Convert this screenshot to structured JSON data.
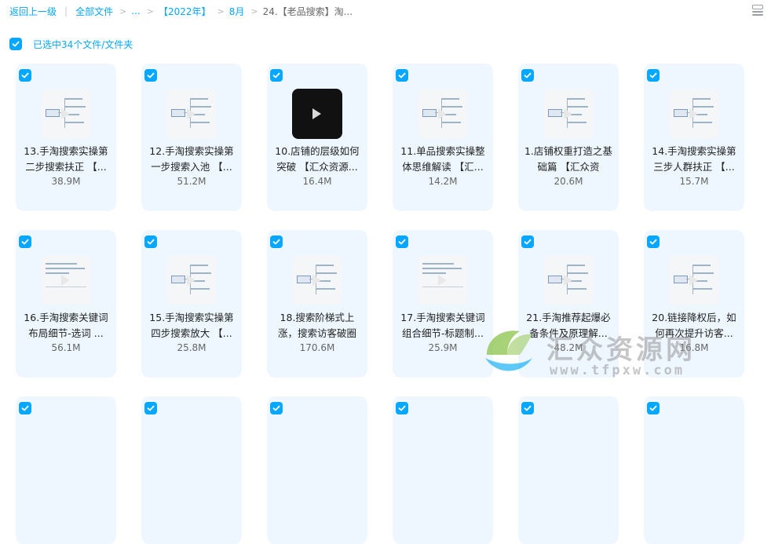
{
  "breadcrumb": {
    "back": "返回上一级",
    "root": "全部文件",
    "ellipsis": "...",
    "year": "【2022年】",
    "month": "8月",
    "current": "24.【老品搜索】淘..."
  },
  "toolbar": {
    "view_toggle_icon": "list-view-icon"
  },
  "selection": {
    "label": "已选中34个文件/文件夹"
  },
  "colors": {
    "accent": "#06a7ff",
    "card_bg": "#eef7ff"
  },
  "files": [
    {
      "name": "13.手淘搜索实操第二步搜索扶正 【...",
      "size": "38.9M",
      "thumb": "mindmap"
    },
    {
      "name": "12.手淘搜索实操第一步搜索入池 【...",
      "size": "51.2M",
      "thumb": "mindmap"
    },
    {
      "name": "10.店铺的层级如何突破 【汇众资源...",
      "size": "16.4M",
      "thumb": "video"
    },
    {
      "name": "11.单品搜索实操整体思维解读 【汇...",
      "size": "14.2M",
      "thumb": "mindmap"
    },
    {
      "name": "1.店铺权重打造之基础篇 【汇众资",
      "size": "20.6M",
      "thumb": "mindmap"
    },
    {
      "name": "14.手淘搜索实操第三步人群扶正 【...",
      "size": "15.7M",
      "thumb": "mindmap"
    },
    {
      "name": "16.手淘搜索关键词布局细节-选词 ...",
      "size": "56.1M",
      "thumb": "doc"
    },
    {
      "name": "15.手淘搜索实操第四步搜索放大 【...",
      "size": "25.8M",
      "thumb": "mindmap"
    },
    {
      "name": "18.搜索阶梯式上涨，搜索访客破圈",
      "size": "170.6M",
      "thumb": "mindmap"
    },
    {
      "name": "17.手淘搜索关键词组合细节-标题制...",
      "size": "25.9M",
      "thumb": "doc"
    },
    {
      "name": "21.手淘推荐起爆必备条件及原理解...",
      "size": "48.2M",
      "thumb": "mindmap"
    },
    {
      "name": "20.链接降权后，如何再次提升访客...",
      "size": "16.8M",
      "thumb": "mindmap"
    },
    {
      "name": "",
      "size": "",
      "thumb": ""
    },
    {
      "name": "",
      "size": "",
      "thumb": ""
    },
    {
      "name": "",
      "size": "",
      "thumb": ""
    },
    {
      "name": "",
      "size": "",
      "thumb": ""
    },
    {
      "name": "",
      "size": "",
      "thumb": ""
    },
    {
      "name": "",
      "size": "",
      "thumb": ""
    }
  ],
  "watermark": {
    "title": "汇众资源网",
    "url": "www.tfpxw.com"
  }
}
